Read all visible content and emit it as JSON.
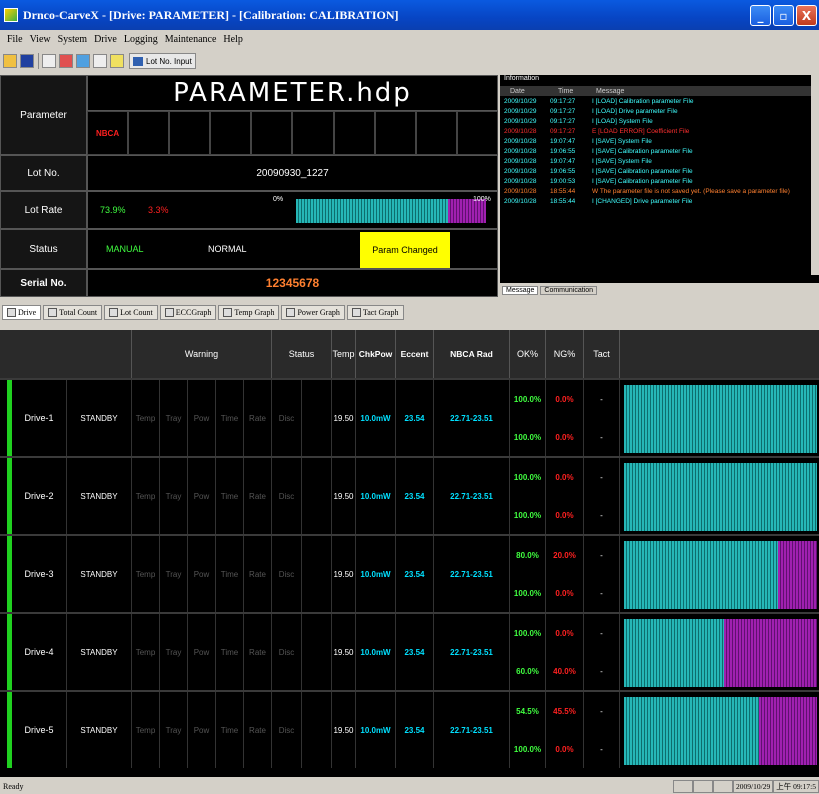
{
  "window": {
    "title": "Drnco-CarveX - [Drive: PARAMETER] - [Calibration: CALIBRATION]",
    "min": "_",
    "max": "▫",
    "close": "X"
  },
  "menu": [
    "File",
    "View",
    "System",
    "Drive",
    "Logging",
    "Maintenance",
    "Help"
  ],
  "toolbar": {
    "lot_input": "Lot No. Input"
  },
  "top": {
    "labels": {
      "parameter": "Parameter",
      "lot_no": "Lot No.",
      "lot_rate": "Lot Rate",
      "status": "Status",
      "serial": "Serial No."
    },
    "param_file": "PARAMETER.hdp",
    "param_cells": [
      "NBCA",
      "",
      "",
      "",
      "",
      "",
      "",
      "",
      "",
      ""
    ],
    "lot_no": "20090930_1227",
    "lot_ok": "73.9%",
    "lot_ng": "3.3%",
    "bar_min": "0%",
    "bar_max": "100%",
    "bar_ng_fraction": 0.2,
    "status_mode": "MANUAL",
    "status_state": "NORMAL",
    "status_changed": "Param Changed",
    "serial_no": "12345678"
  },
  "info": {
    "title": "Information",
    "cols": [
      "Date",
      "Time",
      "Message"
    ],
    "logs": [
      {
        "date": "2009/10/29",
        "time": "09:17:27",
        "msg": "I  [LOAD] Calibration parameter File",
        "color": "#40ffff"
      },
      {
        "date": "2009/10/29",
        "time": "09:17:27",
        "msg": "I  [LOAD] Drive parameter File",
        "color": "#40ffff"
      },
      {
        "date": "2009/10/29",
        "time": "09:17:27",
        "msg": "I  [LOAD] System File",
        "color": "#40ffff"
      },
      {
        "date": "2009/10/28",
        "time": "09:17:27",
        "msg": "E  [LOAD ERROR] Coefficient File",
        "color": "#ff3030"
      },
      {
        "date": "2009/10/28",
        "time": "19:07:47",
        "msg": "I  [SAVE] System File",
        "color": "#40ffff"
      },
      {
        "date": "2009/10/28",
        "time": "19:06:55",
        "msg": "I  [SAVE] Calibration parameter File",
        "color": "#40ffff"
      },
      {
        "date": "2009/10/28",
        "time": "19:07:47",
        "msg": "I  [SAVE] System File",
        "color": "#40ffff"
      },
      {
        "date": "2009/10/28",
        "time": "19:06:55",
        "msg": "I  [SAVE] Calibration parameter File",
        "color": "#40ffff"
      },
      {
        "date": "2009/10/28",
        "time": "19:00:53",
        "msg": "I  [SAVE] Calibration parameter File",
        "color": "#40ffff"
      },
      {
        "date": "2009/10/28",
        "time": "18:55:44",
        "msg": "W  The parameter file is not saved yet. (Please save a parameter file)",
        "color": "#ff8030"
      },
      {
        "date": "2009/10/28",
        "time": "18:55:44",
        "msg": "I  [CHANGED] Drive parameter File",
        "color": "#40ffff"
      }
    ],
    "tabs": [
      "Message",
      "Communication"
    ]
  },
  "tabs": [
    "Drive",
    "Total Count",
    "Lot Count",
    "ECCGraph",
    "Temp Graph",
    "Power Graph",
    "Tact Graph"
  ],
  "grid": {
    "headers": {
      "warning": "Warning",
      "status": "Status",
      "temp": "Temp",
      "chkpow": "ChkPow",
      "eccent": "Eccent",
      "nbca": "NBCA Rad",
      "ok": "OK%",
      "ng": "NG%",
      "tact": "Tact"
    },
    "warn_labels": [
      "Temp",
      "Tray",
      "Pow",
      "Time",
      "Rate"
    ],
    "status_label": "Disc",
    "drives": [
      {
        "name": "Drive-1",
        "state": "STANDBY",
        "temp": "19.50",
        "chkpow": "10.0mW",
        "eccent": "23.54",
        "nbca": "22.71-23.51",
        "ok1": "100.0%",
        "ng1": "0.0%",
        "ok2": "100.0%",
        "ng2": "0.0%",
        "tact1": "-",
        "tact2": "-",
        "ng_fraction": 0
      },
      {
        "name": "Drive-2",
        "state": "STANDBY",
        "temp": "19.50",
        "chkpow": "10.0mW",
        "eccent": "23.54",
        "nbca": "22.71-23.51",
        "ok1": "100.0%",
        "ng1": "0.0%",
        "ok2": "100.0%",
        "ng2": "0.0%",
        "tact1": "-",
        "tact2": "-",
        "ng_fraction": 0
      },
      {
        "name": "Drive-3",
        "state": "STANDBY",
        "temp": "19.50",
        "chkpow": "10.0mW",
        "eccent": "23.54",
        "nbca": "22.71-23.51",
        "ok1": "80.0%",
        "ng1": "20.0%",
        "ok2": "100.0%",
        "ng2": "0.0%",
        "tact1": "-",
        "tact2": "-",
        "ng_fraction": 0.2
      },
      {
        "name": "Drive-4",
        "state": "STANDBY",
        "temp": "19.50",
        "chkpow": "10.0mW",
        "eccent": "23.54",
        "nbca": "22.71-23.51",
        "ok1": "100.0%",
        "ng1": "0.0%",
        "ok2": "60.0%",
        "ng2": "40.0%",
        "tact1": "-",
        "tact2": "-",
        "ng_fraction": 0.48
      },
      {
        "name": "Drive-5",
        "state": "STANDBY",
        "temp": "19.50",
        "chkpow": "10.0mW",
        "eccent": "23.54",
        "nbca": "22.71-23.51",
        "ok1": "54.5%",
        "ng1": "45.5%",
        "ok2": "100.0%",
        "ng2": "0.0%",
        "tact1": "-",
        "tact2": "-",
        "ng_fraction": 0.3
      }
    ]
  },
  "statusbar": {
    "text": "Ready",
    "datetime": "2009/10/29",
    "time": "上午 09:17:5"
  }
}
